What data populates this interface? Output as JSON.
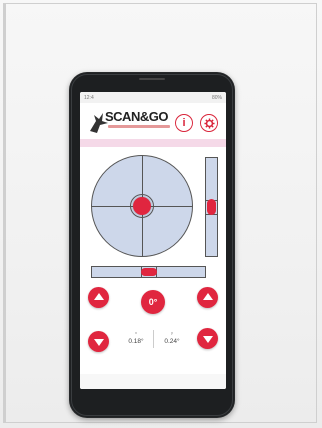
{
  "app": {
    "logo_text": "SCAN&GO",
    "info_icon_glyph": "i",
    "settings_icon": "gear-icon"
  },
  "status_bar": {
    "left": "12:4",
    "right": "80%"
  },
  "level": {
    "circle_bubble": {
      "x": 0.0,
      "y": 0.0
    },
    "vertical_bubble_fraction": 0.5,
    "horizontal_bubble_fraction": 0.5
  },
  "controls": {
    "zero_label": "0°",
    "x_label": "x",
    "y_label": "y",
    "x_value": "0.18°",
    "y_value": "0.24°"
  },
  "colors": {
    "accent": "#e0263f",
    "level_fill": "#cdd7ea",
    "pink_strip": "#f5d9e8"
  }
}
